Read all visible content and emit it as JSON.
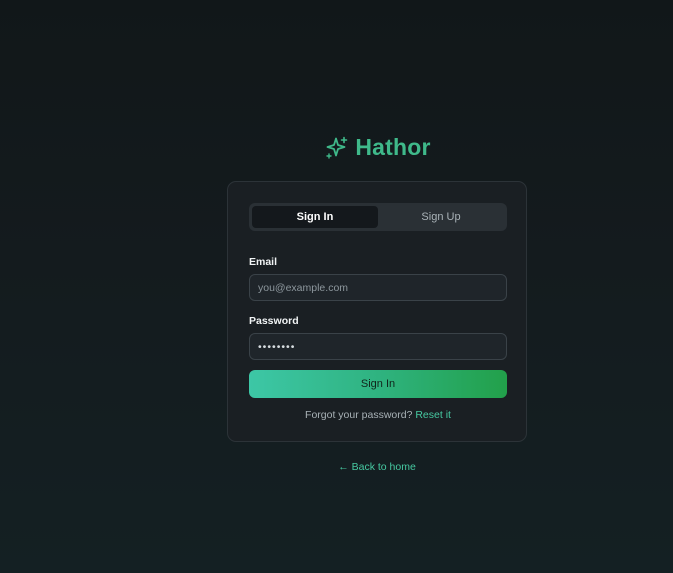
{
  "brand": {
    "name": "Hathor",
    "icon": "sparkle-icon",
    "color": "#3fb98a"
  },
  "auth_tabs": {
    "sign_in": "Sign In",
    "sign_up": "Sign Up",
    "active": "Sign In"
  },
  "form": {
    "email_label": "Email",
    "email_placeholder": "you@example.com",
    "email_value": "",
    "password_label": "Password",
    "password_value": "12345678",
    "submit_label": "Sign In"
  },
  "forgot": {
    "text": "Forgot your password?",
    "link": "Reset it"
  },
  "back_link": "← Back to home",
  "colors": {
    "accent": "#46c9a1",
    "background": "#141b1e",
    "card": "#1a1f23",
    "button_gradient_start": "#3dc7a6",
    "button_gradient_end": "#22a04a"
  }
}
